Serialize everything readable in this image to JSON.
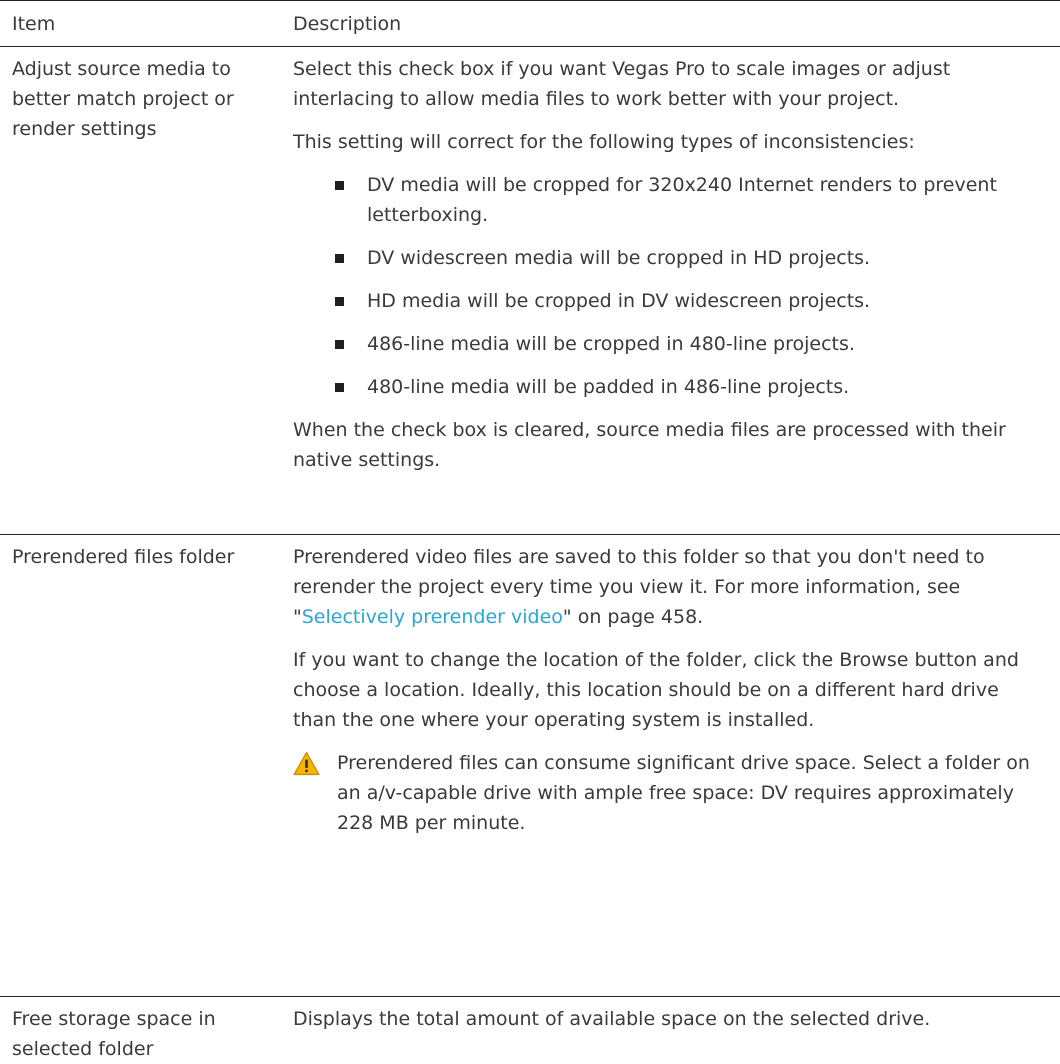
{
  "table": {
    "header": {
      "item": "Item",
      "description": "Description"
    },
    "rows": [
      {
        "item": "Adjust source media to better match project or render settings",
        "intro": "Select this check box if you want Vegas Pro to scale images or adjust interlacing to allow media files to work better with your project.",
        "setting_line": "This setting will correct for the following types of inconsistencies:",
        "bullets": [
          "DV media will be cropped for 320x240 Internet renders to prevent letterboxing.",
          "DV widescreen media will be cropped in HD projects.",
          "HD media will be cropped in DV widescreen projects.",
          "486-line media will be cropped in 480-line projects.",
          "480-line media will be padded in 486-line projects."
        ],
        "outro": "When the check box is cleared, source media files are processed with their native settings."
      },
      {
        "item": "Prerendered files folder",
        "para1_before": "Prerendered video files are saved to this folder so that you don't need to rerender the project every time you view it. For more information, see \"",
        "link": "Selectively prerender video",
        "para1_after": "\" on page 458.",
        "para2": "If you want to change the location of the folder, click the Browse button and choose a location. Ideally, this location should be on a different hard drive than the one where your operating system is installed.",
        "warning": "Prerendered files can consume significant drive space. Select a folder on an a/v-capable drive with ample free space: DV requires approximately 228 MB per minute.",
        "warning_icon": "warning-icon"
      },
      {
        "item": "Free storage space in selected folder",
        "description": "Displays the total amount of available space on the selected drive."
      }
    ]
  },
  "colors": {
    "text": "#3a3a3a",
    "link": "#2aa6d6",
    "rule": "#222222",
    "warning_fill": "#f5b400"
  }
}
